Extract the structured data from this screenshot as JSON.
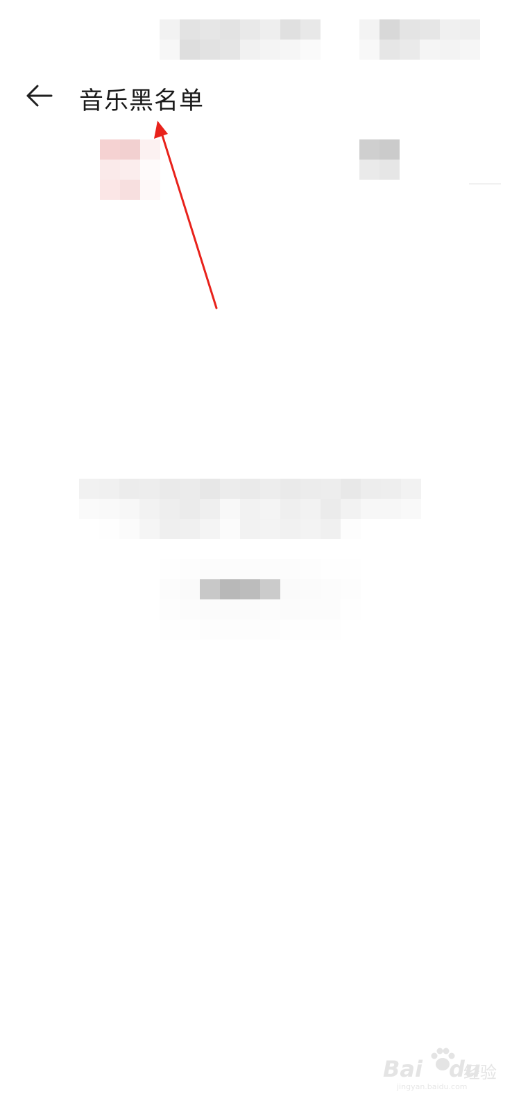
{
  "header": {
    "title": "音乐黑名单",
    "back_icon": "arrow-left-icon"
  },
  "annotation": {
    "arrow_color": "#e8221b"
  },
  "watermark": {
    "brand": "Bai",
    "brand_suffix": "du",
    "sub": "经验",
    "domain": "jingyan.baidu.com"
  },
  "mosaics": {
    "status_left": [
      "#f2f2f2",
      "#e3e3e3",
      "#e6e6e6",
      "#e3e3e3",
      "#e9e9e9",
      "#eeeeee",
      "#e0e0e0",
      "#e8e8e8",
      "#f7f7f7",
      "#dedede",
      "#e2e2e2",
      "#e5e5e5",
      "#f1f1f1",
      "#f4f4f4",
      "#f6f6f6",
      "#fafafa"
    ],
    "status_right": [
      "#f3f3f3",
      "#d8d8d8",
      "#e4e4e4",
      "#e6e6e6",
      "#f0f0f0",
      "#eeeeee",
      "#f8f8f8",
      "#e6e6e6",
      "#eaeaea",
      "#f5f5f5",
      "#f3f3f3",
      "#f6f6f6"
    ],
    "tab_left": [
      "#f5d2d2",
      "#f2d0d0",
      "#fcf1f1",
      "#faeaea",
      "#fbeded",
      "#fefafa",
      "#fbe6e6",
      "#f7dfdf",
      "#fef8f8"
    ],
    "tab_right": [
      "#cfcfcf",
      "#cbcbcb",
      "#eaeaea",
      "#e6e6e6"
    ],
    "empty_text": [
      "#f1f1f1",
      "#f0f0f0",
      "#ececec",
      "#ededed",
      "#eaeaea",
      "#ebebeb",
      "#e7e7e7",
      "#ececec",
      "#eaeaea",
      "#ededed",
      "#eaeaea",
      "#ececec",
      "#ededed",
      "#e8e8e8",
      "#ededed",
      "#eeeeee",
      "#f2f2f2",
      "#fafafa",
      "#f9f9f9",
      "#f7f7f7",
      "#f2f2f2",
      "#eeeeee",
      "#ebebeb",
      "#efefef",
      "#f8f8f8",
      "#f2f2f2",
      "#f4f4f4",
      "#efefef",
      "#f2f2f2",
      "#ebebeb",
      "#f2f2f2",
      "#f7f7f7",
      "#f7f7f7",
      "#f9f9f9",
      "#ffffff",
      "#fefefe",
      "#fbfbfb",
      "#f5f5f5",
      "#efefef",
      "#f0f0f0",
      "#f4f4f4",
      "#fbfbfb",
      "#f2f2f2",
      "#f3f3f3",
      "#f1f1f1",
      "#f3f3f3",
      "#f0f0f0",
      "#fdfdfd",
      "#ffffff",
      "#ffffff",
      "#ffffff"
    ],
    "empty_button": [
      "#fefefe",
      "#fdfdfd",
      "#fcfcfc",
      "#fcfcfc",
      "#fcfcfc",
      "#fcfcfc",
      "#fcfcfc",
      "#fdfdfd",
      "#fefefe",
      "#fefefe",
      "#fcfcfc",
      "#fafafa",
      "#c8c8c8",
      "#b8b8b8",
      "#bcbcbc",
      "#cbcbcb",
      "#fafafa",
      "#fbfbfb",
      "#fcfcfc",
      "#fdfdfd",
      "#fdfdfd",
      "#fcfcfc",
      "#fbfbfb",
      "#fbfbfb",
      "#fbfbfb",
      "#fcfcfc",
      "#fbfbfb",
      "#fcfcfc",
      "#fcfcfc",
      "#fefefe",
      "#fefefe",
      "#fefefe",
      "#fdfdfd",
      "#fdfdfd",
      "#fdfdfd",
      "#fdfdfd",
      "#fefefe",
      "#fefefe",
      "#fefefe",
      "#ffffff"
    ]
  }
}
